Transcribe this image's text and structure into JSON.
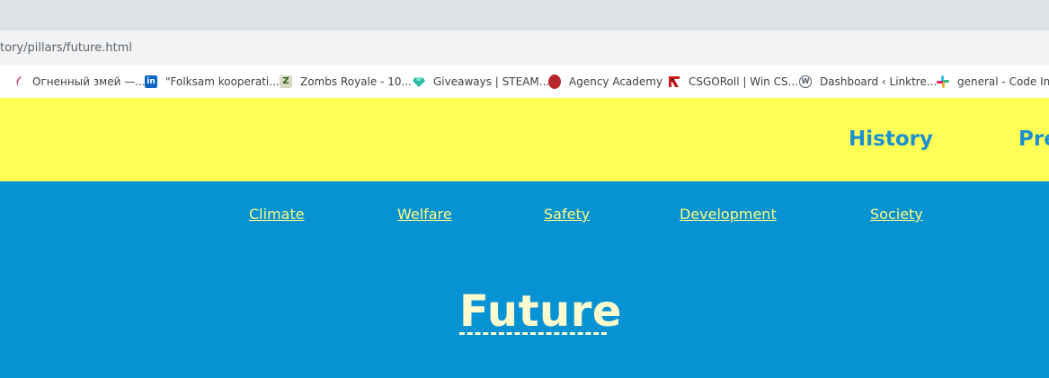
{
  "browser": {
    "url": "tory/pillars/future.html",
    "bookmarks": [
      {
        "label": "Огненный змей —...",
        "icon": "drake-icon",
        "color": "#d84a7d"
      },
      {
        "label": "\"Folksam kooperati...",
        "icon": "linkedin-icon",
        "color": "#0a66c2"
      },
      {
        "label": "Zombs Royale - 10...",
        "icon": "zombs-royale-icon",
        "color": "#2f5e1c"
      },
      {
        "label": "Giveaways | STEAM...",
        "icon": "gem-icon",
        "color": "#2ab9a3"
      },
      {
        "label": "Agency Academy",
        "icon": "red-circle-icon",
        "color": "#b3272d"
      },
      {
        "label": "CSGORoll | Win CS...",
        "icon": "csgoroll-icon",
        "color": "#c81b1b"
      },
      {
        "label": "Dashboard ‹ Linktre...",
        "icon": "wordpress-icon",
        "color": "#4d5a66"
      },
      {
        "label": "general - Code Inst",
        "icon": "slack-icon",
        "color": "#e01e5a"
      }
    ]
  },
  "header": {
    "nav": [
      {
        "label": "History"
      },
      {
        "label": "Pre"
      }
    ],
    "background": "#ffff56",
    "link_color": "#1e90d0"
  },
  "subnav": {
    "links": [
      {
        "label": "Climate"
      },
      {
        "label": "Welfare"
      },
      {
        "label": "Safety"
      },
      {
        "label": "Development"
      },
      {
        "label": "Society"
      }
    ],
    "link_color": "#fffb80"
  },
  "main": {
    "title": "Future",
    "background": "#0792d3",
    "title_color": "#fefad0"
  }
}
